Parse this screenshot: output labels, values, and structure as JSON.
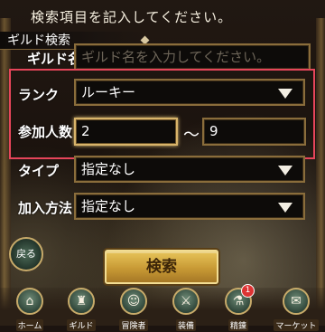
{
  "hint": "検索項目を記入してください。",
  "section_tab": "ギルド検索",
  "fields": {
    "guild_name_label": "ギルド名",
    "guild_name_placeholder": "ギルド名を入力してください。",
    "rank_label": "ランク",
    "rank_value": "ルーキー",
    "members_label": "参加人数",
    "members_min": "2",
    "members_sep": "〜",
    "members_max": "9",
    "type_label": "タイプ",
    "type_value": "指定なし",
    "join_label": "加入方法",
    "join_value": "指定なし"
  },
  "search_button": "検索",
  "back_button": "戻る",
  "nav": [
    {
      "label": "ホーム",
      "icon": "home-icon"
    },
    {
      "label": "ギルド",
      "icon": "guild-icon"
    },
    {
      "label": "冒険者",
      "icon": "adventurer-icon"
    },
    {
      "label": "装備",
      "icon": "equipment-icon"
    },
    {
      "label": "精錬",
      "icon": "refine-icon",
      "badge": "1"
    },
    {
      "label": "マーケット",
      "icon": "market-icon"
    }
  ],
  "colors": {
    "highlight_border": "#e6455a",
    "field_border": "#8a6d3b",
    "button_gold": "#c89a35"
  }
}
